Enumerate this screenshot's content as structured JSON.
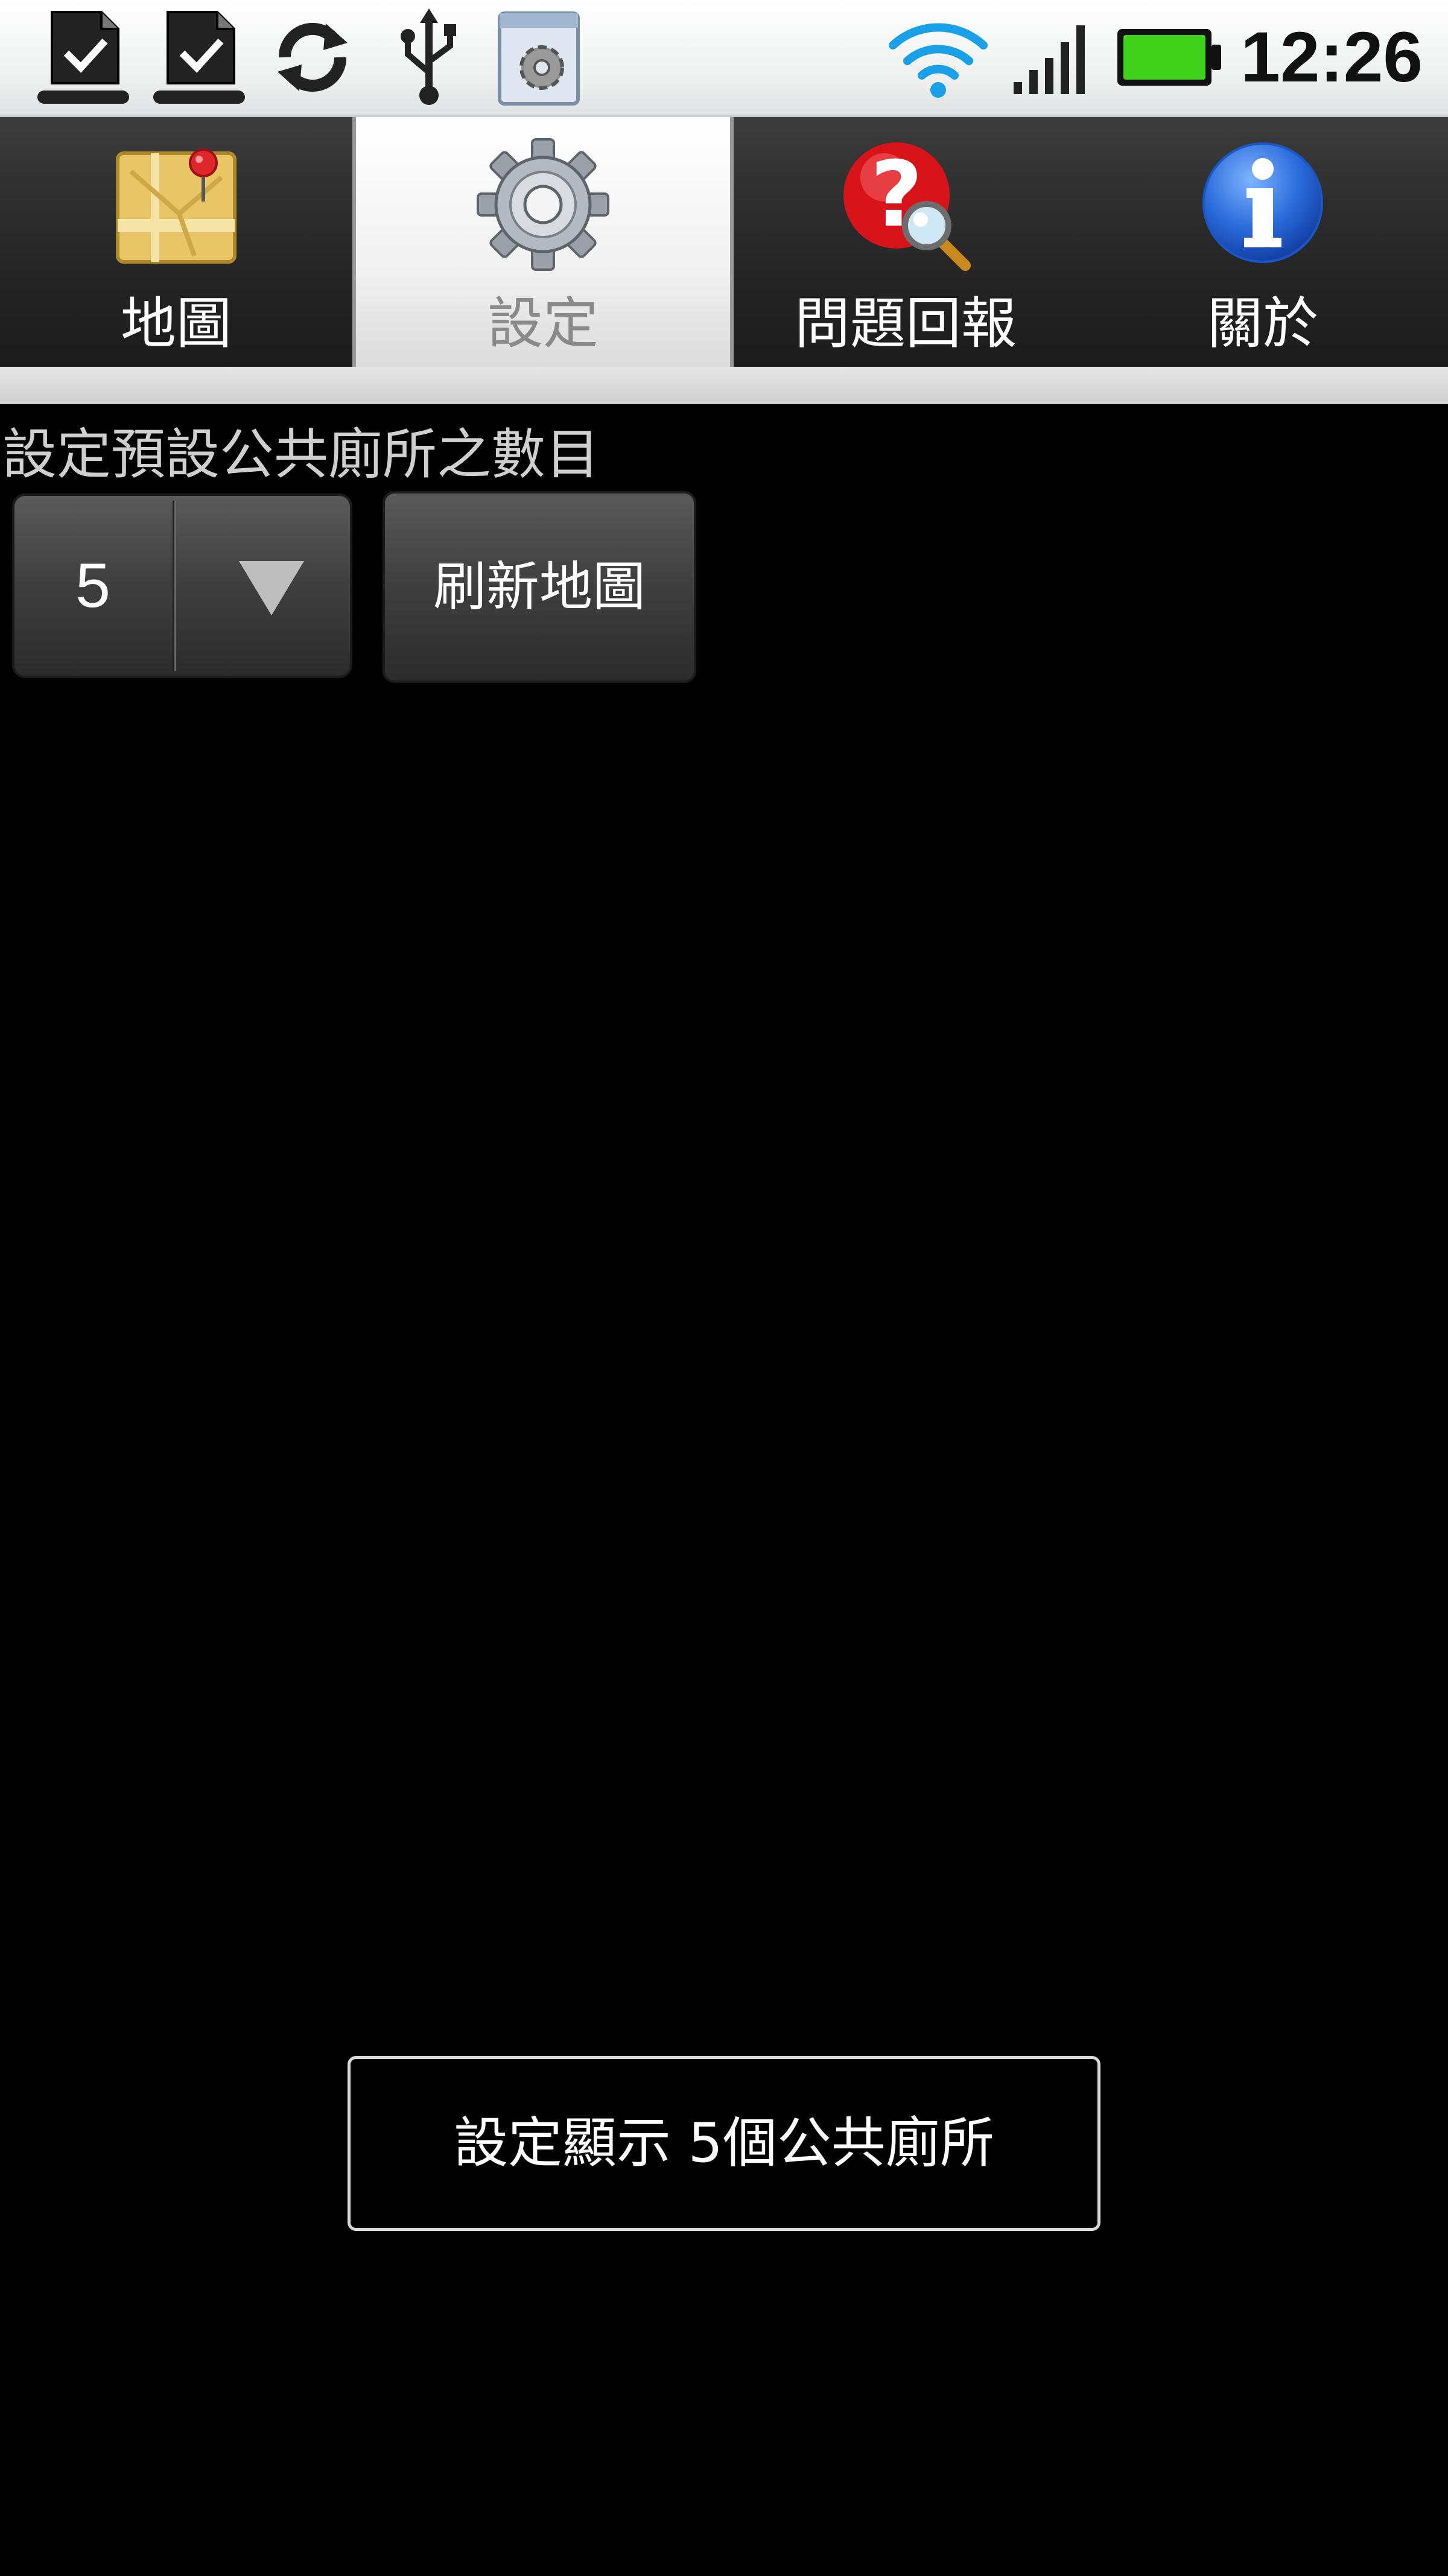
{
  "status_bar": {
    "notification_icons": [
      "download-done-icon",
      "download-done-icon",
      "sync-icon",
      "usb-icon",
      "settings-app-icon"
    ],
    "system_icons": [
      "wifi-icon",
      "signal-icon",
      "battery-icon"
    ],
    "clock": "12:26",
    "wifi_color": "#1aa0e8",
    "battery_color": "#3fd21a"
  },
  "tabs": [
    {
      "label": "地圖",
      "icon": "map-icon",
      "selected": false
    },
    {
      "label": "設定",
      "icon": "gear-icon",
      "selected": true
    },
    {
      "label": "問題回報",
      "icon": "help-search-icon",
      "selected": false
    },
    {
      "label": "關於",
      "icon": "info-icon",
      "selected": false
    }
  ],
  "settings": {
    "label": "設定預設公共廁所之數目",
    "spinner_value": "5",
    "refresh_button_label": "刷新地圖"
  },
  "toast": {
    "message": "設定顯示 5個公共廁所"
  }
}
